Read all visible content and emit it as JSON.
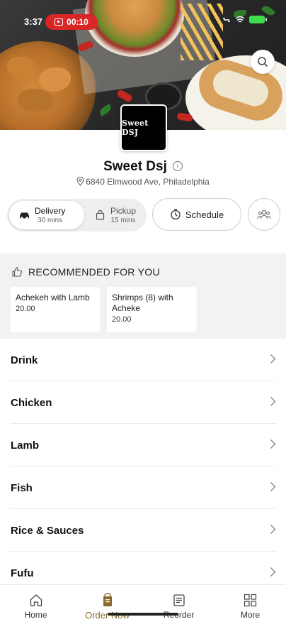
{
  "status_bar": {
    "time": "3:37",
    "recording": "00:10",
    "colors": {
      "recording_bg": "#d92626",
      "battery": "#3ddc4a"
    }
  },
  "hero": {
    "search_icon": "search-icon"
  },
  "store": {
    "logo_text": "Sweet DSJ",
    "name": "Sweet Dsj",
    "address": "6840 Elmwood Ave, Philadelphia"
  },
  "order_modes": {
    "delivery": {
      "label": "Delivery",
      "time": "30 mins",
      "selected": true
    },
    "pickup": {
      "label": "Pickup",
      "time": "15 mins",
      "selected": false
    },
    "schedule_label": "Schedule",
    "group_icon": "group-order-icon"
  },
  "recommended": {
    "title": "RECOMMENDED FOR YOU",
    "items": [
      {
        "name": "Achekeh with Lamb",
        "price": "20.00"
      },
      {
        "name": "Shrimps (8) with Acheke",
        "price": "20.00"
      }
    ]
  },
  "categories": [
    "Drink",
    "Chicken",
    "Lamb",
    "Fish",
    "Rice & Sauces",
    "Fufu"
  ],
  "bottom_nav": {
    "items": [
      {
        "label": "Home",
        "icon": "home-icon"
      },
      {
        "label": "Order Now",
        "icon": "order-bag-icon",
        "active": true
      },
      {
        "label": "Reorder",
        "icon": "receipt-icon"
      },
      {
        "label": "More",
        "icon": "grid-icon"
      }
    ],
    "active_color": "#8a6a2c"
  }
}
